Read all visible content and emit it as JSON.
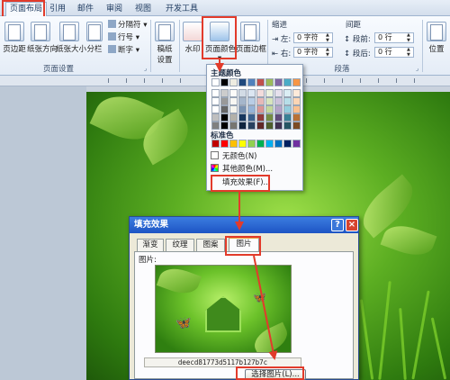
{
  "tabs": {
    "page_layout": "页面布局",
    "references": "引用",
    "mailings": "邮件",
    "review": "审阅",
    "view": "视图",
    "developer": "开发工具"
  },
  "ribbon": {
    "margins": "页边距",
    "orientation": "纸张方向",
    "size": "纸张大小",
    "columns": "分栏",
    "breaks": "分隔符",
    "line_numbers": "行号",
    "hyphenation": "断字",
    "page_setup_group": "页面设置",
    "draft": "稿纸",
    "draft2": "设置",
    "watermark": "水印",
    "page_color": "页面颜色",
    "page_borders": "页面边框",
    "indent_label": "缩进",
    "indent_left_label": "左:",
    "indent_left_value": "0 字符",
    "indent_right_label": "右:",
    "indent_right_value": "0 字符",
    "spacing_label": "间距",
    "spacing_before_label": "段前:",
    "spacing_before_value": "0 行",
    "spacing_after_label": "段后:",
    "spacing_after_value": "0 行",
    "paragraph_group": "段落",
    "position": "位置"
  },
  "color_menu": {
    "theme_colors": "主题颜色",
    "standard_colors": "标准色",
    "no_color": "无颜色(N)",
    "more_colors": "其他颜色(M)...",
    "fill_effects": "填充效果(F)...",
    "theme_top": [
      "#ffffff",
      "#000000",
      "#eeece1",
      "#1f497d",
      "#4f81bd",
      "#c0504d",
      "#9bbb59",
      "#8064a2",
      "#4bacc6",
      "#f79646"
    ],
    "standard": [
      "#c00000",
      "#ff0000",
      "#ffc000",
      "#ffff00",
      "#92d050",
      "#00b050",
      "#00b0f0",
      "#0070c0",
      "#002060",
      "#7030a0"
    ]
  },
  "dialog": {
    "title": "填充效果",
    "help": "?",
    "close": "×",
    "tabs": [
      "渐变",
      "纹理",
      "图案",
      "图片"
    ],
    "picture_label": "图片:",
    "file_name": "deecd81773d5117b127b7c",
    "select_button": "选择图片(L)..."
  },
  "colors": {
    "highlight": "#e23b2b",
    "ribbon_bg": "#e4ecf6",
    "title_blue": "#1d54c4"
  }
}
